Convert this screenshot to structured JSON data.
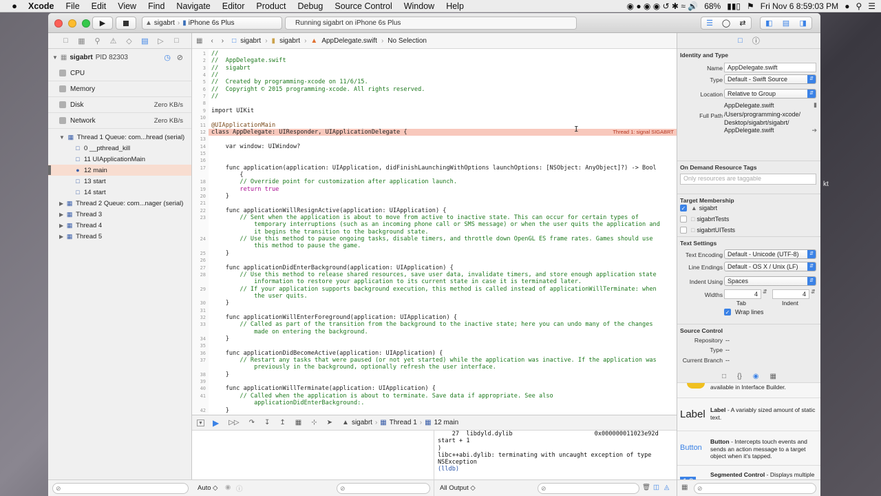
{
  "menubar": {
    "apple": "",
    "items": [
      "Xcode",
      "File",
      "Edit",
      "View",
      "Find",
      "Navigate",
      "Editor",
      "Product",
      "Debug",
      "Source Control",
      "Window",
      "Help"
    ],
    "battery": "68%",
    "clock": "Fri Nov 6  8:59:03 PM"
  },
  "toolbar": {
    "scheme_target": "sigabrt",
    "scheme_device": "iPhone 6s Plus",
    "activity": "Running sigabrt on iPhone 6s Plus"
  },
  "navigator": {
    "process_name": "sigabrt",
    "process_pid": "PID 82303",
    "gauges": [
      {
        "label": "CPU",
        "value": ""
      },
      {
        "label": "Memory",
        "value": ""
      },
      {
        "label": "Disk",
        "value": "Zero KB/s"
      },
      {
        "label": "Network",
        "value": "Zero KB/s"
      }
    ],
    "thread1": "Thread 1 Queue: com...hread (serial)",
    "frames": [
      "0 __pthread_kill",
      "11 UIApplicationMain",
      "12 main",
      "13 start",
      "14 start"
    ],
    "thread2": "Thread 2 Queue: com...nager (serial)",
    "threads": [
      "Thread 3",
      "Thread 4",
      "Thread 5"
    ]
  },
  "jumpbar": {
    "project": "sigabrt",
    "group": "sigabrt",
    "file": "AppDelegate.swift",
    "selection": "No Selection"
  },
  "code": {
    "lines": [
      {
        "n": "1",
        "t": "//",
        "c": "comment"
      },
      {
        "n": "2",
        "t": "//  AppDelegate.swift",
        "c": "comment"
      },
      {
        "n": "3",
        "t": "//  sigabrt",
        "c": "comment"
      },
      {
        "n": "4",
        "t": "//",
        "c": "comment"
      },
      {
        "n": "5",
        "t": "//  Created by programming-xcode on 11/6/15.",
        "c": "comment"
      },
      {
        "n": "6",
        "t": "//  Copyright © 2015 programming-xcode. All rights reserved.",
        "c": "comment"
      },
      {
        "n": "7",
        "t": "//",
        "c": "comment"
      },
      {
        "n": "8",
        "t": "",
        "c": "plain"
      },
      {
        "n": "9",
        "t": "import UIKit",
        "c": "plain"
      },
      {
        "n": "10",
        "t": "",
        "c": "plain"
      },
      {
        "n": "11",
        "t": "@UIApplicationMain",
        "c": "attr"
      },
      {
        "n": "12",
        "t": "class AppDelegate: UIResponder, UIApplicationDelegate {",
        "c": "plain"
      },
      {
        "n": "13",
        "t": "",
        "c": "plain"
      },
      {
        "n": "14",
        "t": "    var window: UIWindow?",
        "c": "plain"
      },
      {
        "n": "15",
        "t": "",
        "c": "plain"
      },
      {
        "n": "16",
        "t": "",
        "c": "plain"
      },
      {
        "n": "17",
        "t": "    func application(application: UIApplication, didFinishLaunchingWithOptions launchOptions: [NSObject: AnyObject]?) -> Bool",
        "c": "plain"
      },
      {
        "n": "",
        "t": "        {",
        "c": "plain"
      },
      {
        "n": "18",
        "t": "        // Override point for customization after application launch.",
        "c": "comment"
      },
      {
        "n": "19",
        "t": "        return true",
        "c": "keyword"
      },
      {
        "n": "20",
        "t": "    }",
        "c": "plain"
      },
      {
        "n": "21",
        "t": "",
        "c": "plain"
      },
      {
        "n": "22",
        "t": "    func applicationWillResignActive(application: UIApplication) {",
        "c": "plain"
      },
      {
        "n": "23",
        "t": "        // Sent when the application is about to move from active to inactive state. This can occur for certain types of",
        "c": "comment"
      },
      {
        "n": "",
        "t": "            temporary interruptions (such as an incoming phone call or SMS message) or when the user quits the application and",
        "c": "comment"
      },
      {
        "n": "",
        "t": "            it begins the transition to the background state.",
        "c": "comment"
      },
      {
        "n": "24",
        "t": "        // Use this method to pause ongoing tasks, disable timers, and throttle down OpenGL ES frame rates. Games should use",
        "c": "comment"
      },
      {
        "n": "",
        "t": "            this method to pause the game.",
        "c": "comment"
      },
      {
        "n": "25",
        "t": "    }",
        "c": "plain"
      },
      {
        "n": "26",
        "t": "",
        "c": "plain"
      },
      {
        "n": "27",
        "t": "    func applicationDidEnterBackground(application: UIApplication) {",
        "c": "plain"
      },
      {
        "n": "28",
        "t": "        // Use this method to release shared resources, save user data, invalidate timers, and store enough application state",
        "c": "comment"
      },
      {
        "n": "",
        "t": "            information to restore your application to its current state in case it is terminated later.",
        "c": "comment"
      },
      {
        "n": "29",
        "t": "        // If your application supports background execution, this method is called instead of applicationWillTerminate: when",
        "c": "comment"
      },
      {
        "n": "",
        "t": "            the user quits.",
        "c": "comment"
      },
      {
        "n": "30",
        "t": "    }",
        "c": "plain"
      },
      {
        "n": "31",
        "t": "",
        "c": "plain"
      },
      {
        "n": "32",
        "t": "    func applicationWillEnterForeground(application: UIApplication) {",
        "c": "plain"
      },
      {
        "n": "33",
        "t": "        // Called as part of the transition from the background to the inactive state; here you can undo many of the changes",
        "c": "comment"
      },
      {
        "n": "",
        "t": "            made on entering the background.",
        "c": "comment"
      },
      {
        "n": "34",
        "t": "    }",
        "c": "plain"
      },
      {
        "n": "35",
        "t": "",
        "c": "plain"
      },
      {
        "n": "36",
        "t": "    func applicationDidBecomeActive(application: UIApplication) {",
        "c": "plain"
      },
      {
        "n": "37",
        "t": "        // Restart any tasks that were paused (or not yet started) while the application was inactive. If the application was",
        "c": "comment"
      },
      {
        "n": "",
        "t": "            previously in the background, optionally refresh the user interface.",
        "c": "comment"
      },
      {
        "n": "38",
        "t": "    }",
        "c": "plain"
      },
      {
        "n": "39",
        "t": "",
        "c": "plain"
      },
      {
        "n": "40",
        "t": "    func applicationWillTerminate(application: UIApplication) {",
        "c": "plain"
      },
      {
        "n": "41",
        "t": "        // Called when the application is about to terminate. Save data if appropriate. See also",
        "c": "comment"
      },
      {
        "n": "",
        "t": "            applicationDidEnterBackground:.",
        "c": "comment"
      },
      {
        "n": "42",
        "t": "    }",
        "c": "plain"
      }
    ],
    "error_line_index": 11,
    "error_label": "Thread 1: signal SIGABRT"
  },
  "debugbar": {
    "project": "sigabrt",
    "thread": "Thread 1",
    "frame": "12 main"
  },
  "console": {
    "lines": [
      "    27  libdyld.dylib                       0x000000011023e92d",
      "start + 1",
      ")",
      "libc++abi.dylib: terminating with uncaught exception of type",
      "NSException",
      "(lldb)"
    ]
  },
  "bottom": {
    "auto_label": "Auto ◇",
    "all_output_label": "All Output ◇"
  },
  "inspector": {
    "identity_title": "Identity and Type",
    "name_label": "Name",
    "name_value": "AppDelegate.swift",
    "type_label": "Type",
    "type_value": "Default - Swift Source",
    "location_label": "Location",
    "location_value": "Relative to Group",
    "location_file": "AppDelegate.swift",
    "fullpath_label": "Full Path",
    "fullpath_lines": [
      "/Users/programming-xcode/",
      "Desktop/sigabrt/sigabrt/",
      "AppDelegate.swift"
    ],
    "odr_title": "On Demand Resource Tags",
    "odr_placeholder": "Only resources are taggable",
    "membership_title": "Target Membership",
    "targets": [
      {
        "label": "sigabrt",
        "checked": true
      },
      {
        "label": "sigabrtTests",
        "checked": false
      },
      {
        "label": "sigabrtUITests",
        "checked": false
      }
    ],
    "text_title": "Text Settings",
    "encoding_label": "Text Encoding",
    "encoding_value": "Default - Unicode (UTF-8)",
    "endings_label": "Line Endings",
    "endings_value": "Default - OS X / Unix (LF)",
    "indent_label": "Indent Using",
    "indent_value": "Spaces",
    "widths_label": "Widths",
    "tab_value": "4",
    "indent_width_value": "4",
    "tab_caption": "Tab",
    "indent_caption": "Indent",
    "wrap_label": "Wrap lines",
    "sc_title": "Source Control",
    "repo_label": "Repository",
    "repo_value": "--",
    "sctype_label": "Type",
    "sctype_value": "--",
    "branch_label": "Current Branch",
    "branch_value": "--"
  },
  "library": {
    "partial_text": "available in Interface Builder.",
    "items": [
      {
        "icon": "Label",
        "title": "Label",
        "desc": " - A variably sized amount of static text."
      },
      {
        "icon": "Button",
        "title": "Button",
        "desc": " - Intercepts touch events and sends an action message to a target object when it's tapped."
      },
      {
        "icon": "1 2",
        "title": "Segmented Control",
        "desc": " - Displays multiple segments, each of which"
      }
    ]
  },
  "colors": {
    "accent": "#3b82e6",
    "error_band": "#f8c8bc",
    "comment": "#1f7a1f",
    "keyword": "#aa0d91"
  }
}
